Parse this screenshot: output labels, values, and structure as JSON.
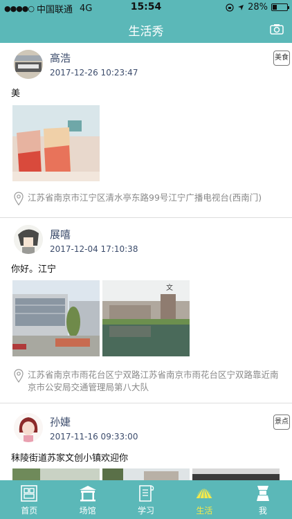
{
  "status": {
    "carrier": "中国联通",
    "network": "4G",
    "time": "15:54",
    "battery": "28%",
    "battery_level": 0.28
  },
  "header": {
    "title": "生活秀",
    "camera_icon": "camera-icon"
  },
  "posts": [
    {
      "username": "高浩",
      "time": "2017-12-26 10:23:47",
      "tag": "美食",
      "content": "美",
      "location": "江苏省南京市江宁区清水亭东路99号江宁广播电视台(西南门)"
    },
    {
      "username": "展嘻",
      "time": "2017-12-04 17:10:38",
      "tag": "",
      "content": "你好。江宁",
      "location": "江苏省南京市雨花台区宁双路江苏省南京市雨花台区宁双路靠近南京市公安局交通管理局第八大队"
    },
    {
      "username": "孙婕",
      "time": "2017-11-16 09:33:00",
      "tag": "景点",
      "content": "秣陵街道苏家文创小镇欢迎你",
      "location": ""
    }
  ],
  "tabs": [
    {
      "label": "首页",
      "icon": "home-icon",
      "active": false
    },
    {
      "label": "场馆",
      "icon": "venue-icon",
      "active": false
    },
    {
      "label": "学习",
      "icon": "study-icon",
      "active": false
    },
    {
      "label": "生活",
      "icon": "life-icon",
      "active": true
    },
    {
      "label": "我",
      "icon": "profile-icon",
      "active": false
    }
  ],
  "colors": {
    "accent": "#5bb8b8",
    "active_tab": "#f5e94a",
    "username": "#3b4b6b"
  }
}
